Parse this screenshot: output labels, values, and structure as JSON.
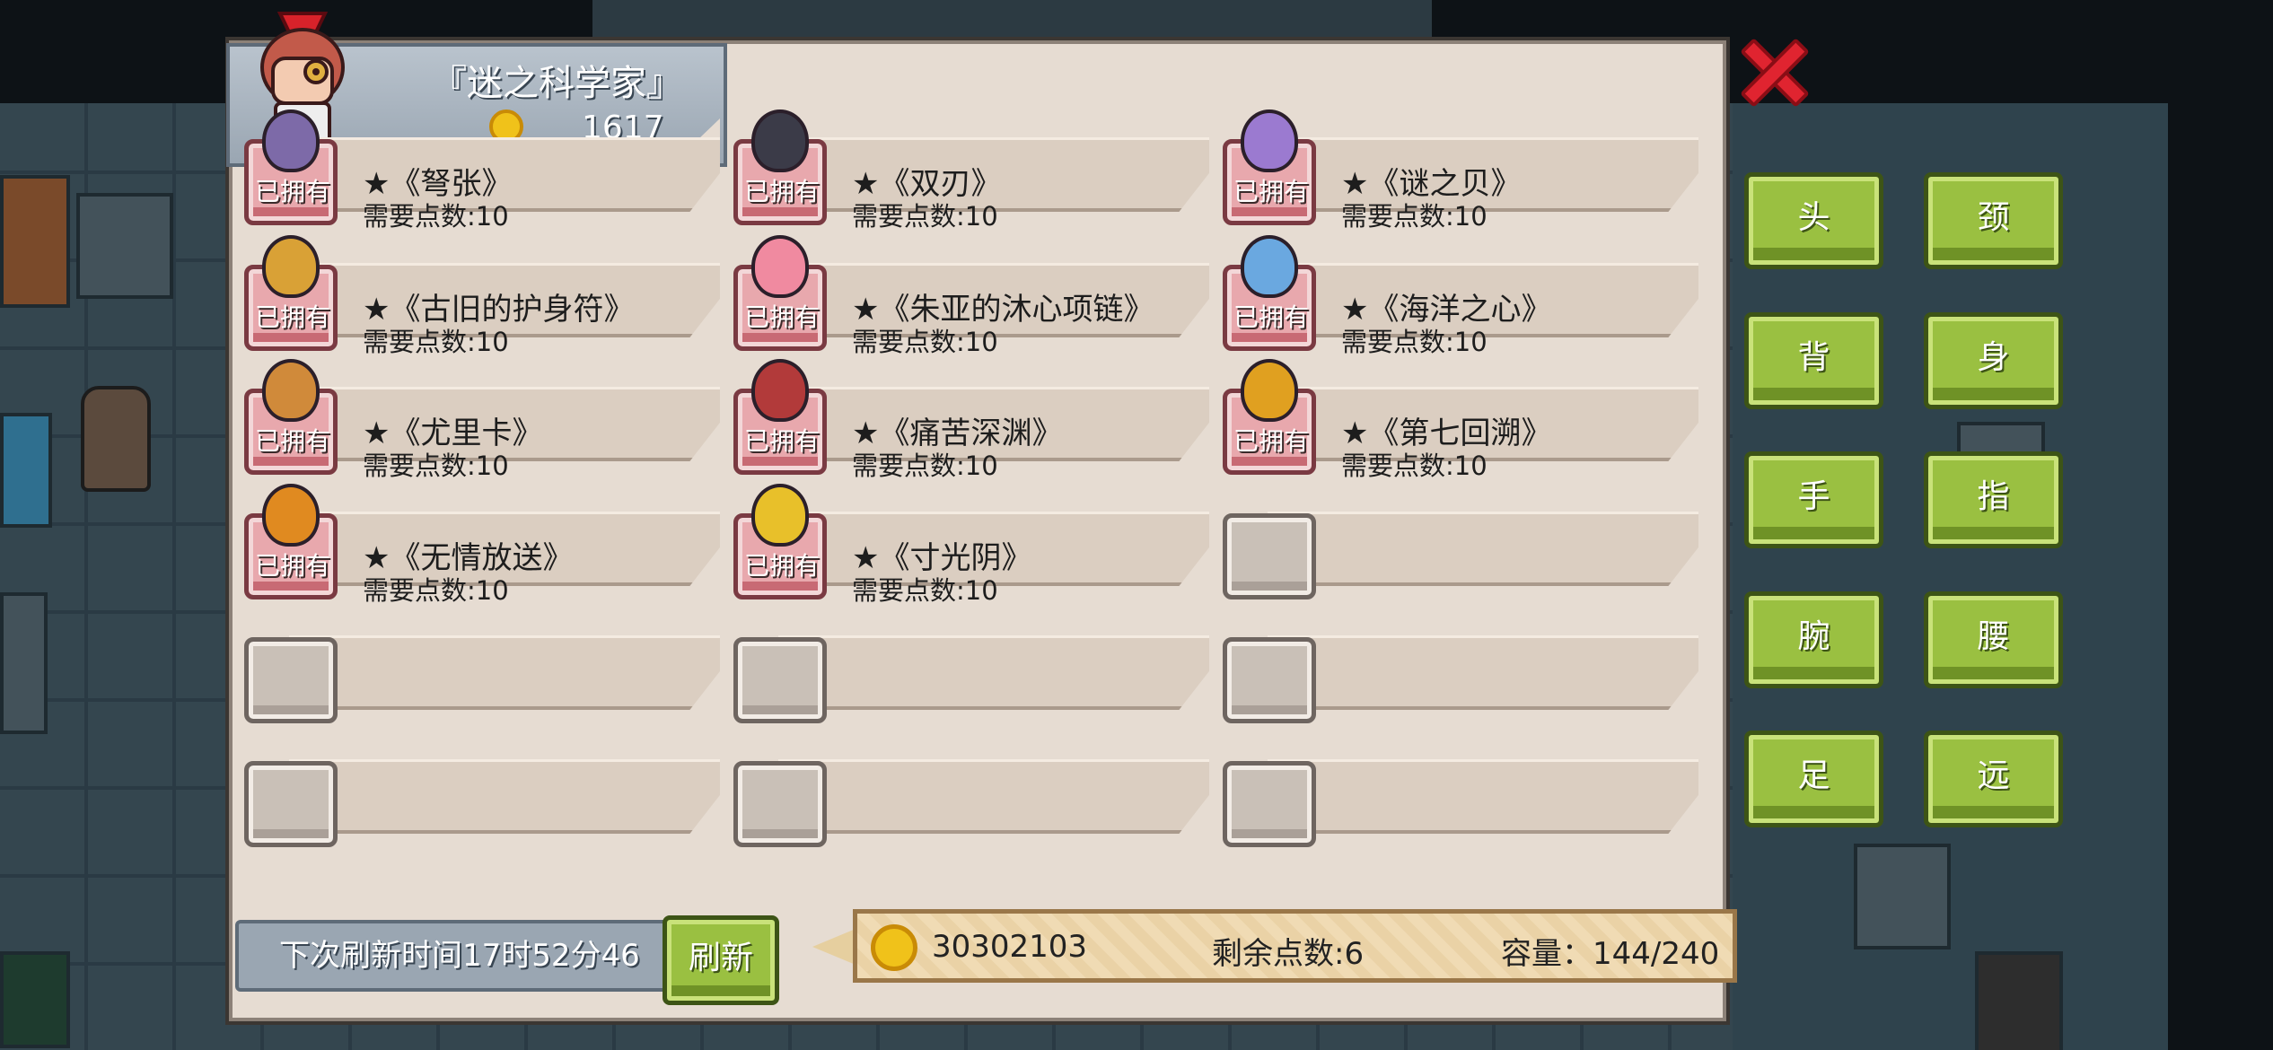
{
  "header": {
    "title": "『迷之科学家』",
    "coins": "1617"
  },
  "owned_tag": "已拥有",
  "items": [
    {
      "name": "★《弩张》",
      "cost": "需要点数:10",
      "owned": true,
      "color": "#7d6aa8"
    },
    {
      "name": "★《双刃》",
      "cost": "需要点数:10",
      "owned": true,
      "color": "#3b3b48"
    },
    {
      "name": "★《谜之贝》",
      "cost": "需要点数:10",
      "owned": true,
      "color": "#9b7ad0"
    },
    {
      "name": "★《古旧的护身符》",
      "cost": "需要点数:10",
      "owned": true,
      "color": "#d9a136"
    },
    {
      "name": "★《朱亚的沐心项链》",
      "cost": "需要点数:10",
      "owned": true,
      "color": "#f08aa0"
    },
    {
      "name": "★《海洋之心》",
      "cost": "需要点数:10",
      "owned": true,
      "color": "#6aa8e0"
    },
    {
      "name": "★《尤里卡》",
      "cost": "需要点数:10",
      "owned": true,
      "color": "#d08a3a"
    },
    {
      "name": "★《痛苦深渊》",
      "cost": "需要点数:10",
      "owned": true,
      "color": "#b23a3a"
    },
    {
      "name": "★《第七回溯》",
      "cost": "需要点数:10",
      "owned": true,
      "color": "#e0a020"
    },
    {
      "name": "★《无情放送》",
      "cost": "需要点数:10",
      "owned": true,
      "color": "#e08a20"
    },
    {
      "name": "★《寸光阴》",
      "cost": "需要点数:10",
      "owned": true,
      "color": "#e8c02a"
    },
    {
      "name": "",
      "cost": "",
      "owned": false
    },
    {
      "name": "",
      "cost": "",
      "owned": false
    },
    {
      "name": "",
      "cost": "",
      "owned": false
    },
    {
      "name": "",
      "cost": "",
      "owned": false
    },
    {
      "name": "",
      "cost": "",
      "owned": false
    },
    {
      "name": "",
      "cost": "",
      "owned": false
    },
    {
      "name": "",
      "cost": "",
      "owned": false
    }
  ],
  "categories": [
    "头",
    "颈",
    "背",
    "身",
    "手",
    "指",
    "腕",
    "腰",
    "足",
    "远"
  ],
  "footer": {
    "refresh_time": "下次刷新时间17时52分46",
    "refresh_label": "刷新",
    "gold": "30302103",
    "points": "剩余点数:6",
    "capacity": "容量：144/240"
  },
  "icons": [
    "close-icon",
    "coin-icon",
    "scientist-avatar"
  ]
}
